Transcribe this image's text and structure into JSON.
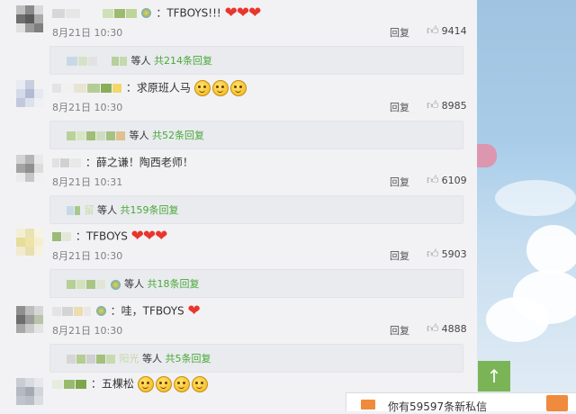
{
  "comments": [
    {
      "text": "：TFBOYS!!!",
      "hearts": "❤❤❤",
      "smiles": 0,
      "time": "8月21日 10:30",
      "reply_label": "回复",
      "likes": "9414",
      "sub_prefix": "等人",
      "sub_count": "共214条回复"
    },
    {
      "text": "：求原班人马",
      "hearts": "",
      "smiles": 3,
      "time": "8月21日 10:30",
      "reply_label": "回复",
      "likes": "8985",
      "sub_prefix": "等人",
      "sub_count": "共52条回复"
    },
    {
      "text": "：薛之谦！陶西老师！",
      "hearts": "",
      "smiles": 0,
      "time": "8月21日 10:31",
      "reply_label": "回复",
      "likes": "6109",
      "sub_prefix": "等人",
      "sub_mid": "留",
      "sub_count": "共159条回复"
    },
    {
      "text": "：TFBOYS",
      "hearts": "❤❤❤",
      "smiles": 0,
      "time": "8月21日 10:30",
      "reply_label": "回复",
      "likes": "5903",
      "sub_prefix": "等人",
      "sub_count": "共18条回复"
    },
    {
      "text": "：哇，TFBOYS",
      "hearts": "❤",
      "smiles": 0,
      "time": "8月21日 10:30",
      "reply_label": "回复",
      "likes": "4888",
      "sub_prefix": "等人",
      "sub_mid": "阳光",
      "sub_count": "共5条回复"
    },
    {
      "text": "：五棵松",
      "hearts": "",
      "smiles": 4
    }
  ],
  "scroll_top_icon": "arrow-up-icon",
  "private_message": {
    "text": "你有59597条新私信"
  },
  "colors": {
    "accent_green": "#4aa838",
    "heart_red": "#e8362d",
    "totop_green": "#7bb456",
    "pm_orange": "#f08a3c"
  }
}
